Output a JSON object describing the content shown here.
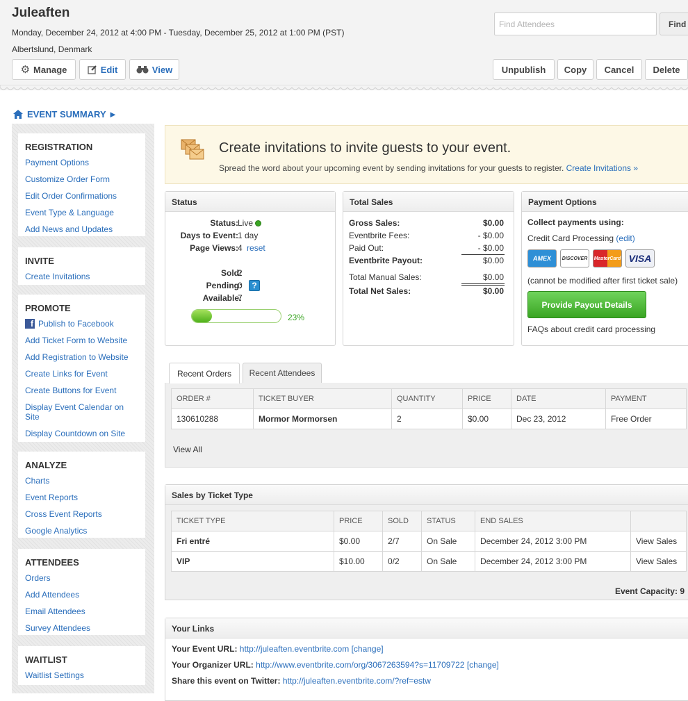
{
  "header": {
    "title": "Juleaften",
    "dates": "Monday, December 24, 2012 at 4:00 PM - Tuesday, December 25, 2012 at 1:00 PM (PST)",
    "location": "Albertslund, Denmark",
    "search_placeholder": "Find Attendees",
    "find_label": "Find",
    "manage_label": "Manage",
    "edit_label": "Edit",
    "view_label": "View",
    "unpublish_label": "Unpublish",
    "copy_label": "Copy",
    "cancel_label": "Cancel",
    "delete_label": "Delete"
  },
  "summary_link": "EVENT SUMMARY ►",
  "sidebar": {
    "registration": {
      "title": "REGISTRATION",
      "items": [
        "Payment Options",
        "Customize Order Form",
        "Edit Order Confirmations",
        "Event Type & Language",
        "Add News and Updates"
      ]
    },
    "invite": {
      "title": "INVITE",
      "items": [
        "Create Invitations"
      ]
    },
    "promote": {
      "title": "PROMOTE",
      "items": [
        "Publish to Facebook",
        "Add Ticket Form to Website",
        "Add Registration to Website",
        "Create Links for Event",
        "Create Buttons for Event",
        "Display Event Calendar on Site",
        "Display Countdown on Site"
      ]
    },
    "analyze": {
      "title": "ANALYZE",
      "items": [
        "Charts",
        "Event Reports",
        "Cross Event Reports",
        "Google Analytics"
      ]
    },
    "attendees": {
      "title": "ATTENDEES",
      "items": [
        "Orders",
        "Add Attendees",
        "Email Attendees",
        "Survey Attendees"
      ]
    },
    "waitlist": {
      "title": "WAITLIST",
      "items": [
        "Waitlist Settings"
      ]
    }
  },
  "promo": {
    "title": "Create invitations to invite guests to your event.",
    "text": "Spread the word about your upcoming event by sending invitations for your guests to register.",
    "link": "Create Invitations »"
  },
  "status": {
    "title": "Status",
    "status_label": "Status:",
    "status_value": "Live",
    "days_label": "Days to Event:",
    "days_value": "1 day",
    "views_label": "Page Views:",
    "views_value": "4",
    "reset_label": "reset",
    "sold_label": "Sold:",
    "sold_value": "2",
    "pending_label": "Pending:",
    "pending_value": "0",
    "available_label": "Available:",
    "available_value": "7",
    "help_glyph": "?",
    "progress_text": "23%",
    "progress_fraction": 0.23
  },
  "sales": {
    "title": "Total Sales",
    "rows": [
      {
        "label": "Gross Sales:",
        "value": "$0.00"
      },
      {
        "label": "Eventbrite Fees:",
        "value": "- $0.00"
      },
      {
        "label": "Paid Out:",
        "value": "- $0.00"
      },
      {
        "label": "Eventbrite Payout:",
        "value": "$0.00"
      },
      {
        "label": "Total Manual Sales:",
        "value": "$0.00"
      },
      {
        "label": "Total Net Sales:",
        "value": "$0.00"
      }
    ]
  },
  "payment": {
    "title": "Payment Options",
    "collect": "Collect payments using:",
    "method": "Credit Card Processing",
    "edit_link": "(edit)",
    "cards": [
      "AMEX",
      "DISCOVER",
      "MasterCard",
      "VISA"
    ],
    "note": "(cannot be modified after first ticket sale)",
    "payout_button": "Provide Payout Details",
    "faq_link": "FAQs about credit card processing"
  },
  "orders": {
    "tabs": [
      "Recent Orders",
      "Recent Attendees"
    ],
    "headers": [
      "ORDER #",
      "TICKET BUYER",
      "QUANTITY",
      "PRICE",
      "DATE",
      "PAYMENT"
    ],
    "rows": [
      [
        "130610288",
        "Mormor Mormorsen",
        "2",
        "$0.00",
        "Dec 23, 2012",
        "Free Order"
      ]
    ],
    "view_all": "View All"
  },
  "ticket_types": {
    "title": "Sales by Ticket Type",
    "headers": [
      "TICKET TYPE",
      "PRICE",
      "SOLD",
      "STATUS",
      "END SALES",
      ""
    ],
    "rows": [
      [
        "Fri entré",
        "$0.00",
        "2/7",
        "On Sale",
        "December 24, 2012 3:00 PM",
        "View Sales"
      ],
      [
        "VIP",
        "$10.00",
        "0/2",
        "On Sale",
        "December 24, 2012 3:00 PM",
        "View Sales"
      ]
    ],
    "capacity_label": "Event Capacity:",
    "capacity_value": "9"
  },
  "links": {
    "title": "Your Links",
    "event_url_label": "Your Event URL:",
    "event_url": "http://juleaften.eventbrite.com",
    "organizer_url_label": "Your Organizer URL:",
    "organizer_url": "http://www.eventbrite.com/org/3067263594?s=11709722",
    "change_label": "[change]",
    "twitter_label": "Share this event on Twitter:",
    "twitter_url": "http://juleaften.eventbrite.com/?ref=estw"
  },
  "colors": {
    "link": "#2a6ebb",
    "live_dot": "#3aa523",
    "promo_bg": "#fdf8e6"
  }
}
